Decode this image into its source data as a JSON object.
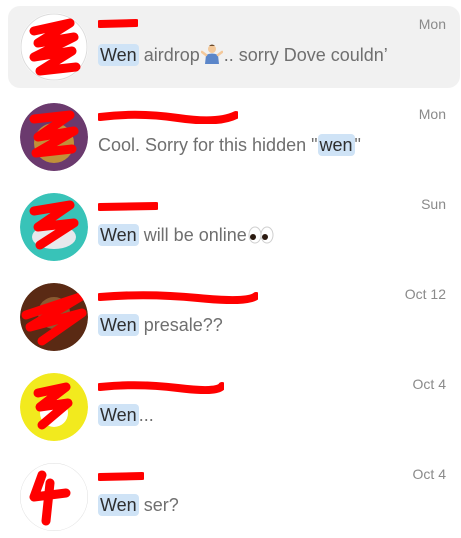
{
  "colors": {
    "highlight": "#cfe3f6",
    "redaction": "#ff0000",
    "selected_row_bg": "#f1f1f1",
    "date_text": "#8a8a8a",
    "preview_text": "#6f6f6f"
  },
  "chats": [
    {
      "date": "Mon",
      "preview_highlight": "Wen",
      "preview_before": "",
      "preview_after": " airdrop",
      "preview_emoji": "person-shrugging-emoji",
      "preview_tail": ".. sorry Dove couldn’",
      "selected": true,
      "name_redacted": true
    },
    {
      "date": "Mon",
      "preview_before": "Cool. Sorry for this hidden \"",
      "preview_highlight": "wen",
      "preview_after": "\"",
      "name_redacted": true
    },
    {
      "date": "Sun",
      "preview_highlight": "Wen",
      "preview_before": "",
      "preview_after": " will be online",
      "preview_emoji": "eyes-emoji",
      "name_redacted": true
    },
    {
      "date": "Oct 12",
      "preview_highlight": "Wen",
      "preview_before": "",
      "preview_after": " presale??",
      "name_redacted": true
    },
    {
      "date": "Oct 4",
      "preview_highlight": "Wen",
      "preview_before": "",
      "preview_after": "...",
      "name_redacted": true
    },
    {
      "date": "Oct 4",
      "preview_highlight": "Wen",
      "preview_before": "",
      "preview_after": " ser?",
      "name_redacted": true
    }
  ]
}
